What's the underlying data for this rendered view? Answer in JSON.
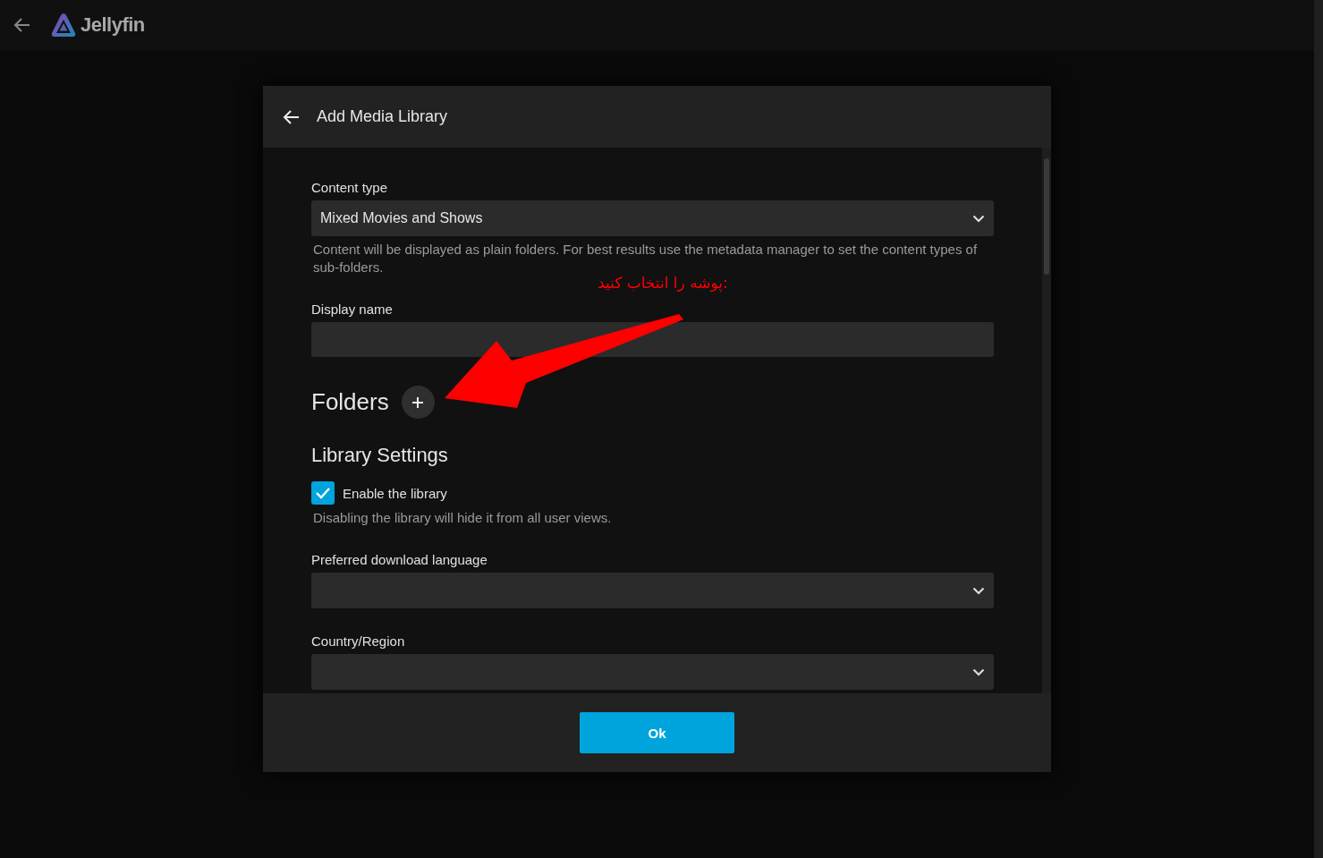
{
  "app_bar": {
    "title": "Jellyfin"
  },
  "dialog": {
    "title": "Add Media Library",
    "fields": [
      {
        "kind": "select",
        "label": "Content type",
        "value": "Mixed Movies and Shows",
        "help": "Content will be displayed as plain folders. For best results use the metadata manager to set the content types of sub-folders."
      },
      {
        "kind": "text",
        "label": "Display name"
      }
    ],
    "folders": {
      "heading": "Folders"
    },
    "library_settings": {
      "heading": "Library Settings",
      "enable": {
        "label": "Enable the library",
        "checked": true,
        "help": "Disabling the library will hide it from all user views."
      },
      "fields": [
        {
          "kind": "select",
          "label": "Preferred download language"
        },
        {
          "kind": "select",
          "label": "Country/Region"
        }
      ]
    },
    "button": "Ok"
  },
  "annotation": {
    "text": "پوشه را انتخاب کنید:"
  }
}
